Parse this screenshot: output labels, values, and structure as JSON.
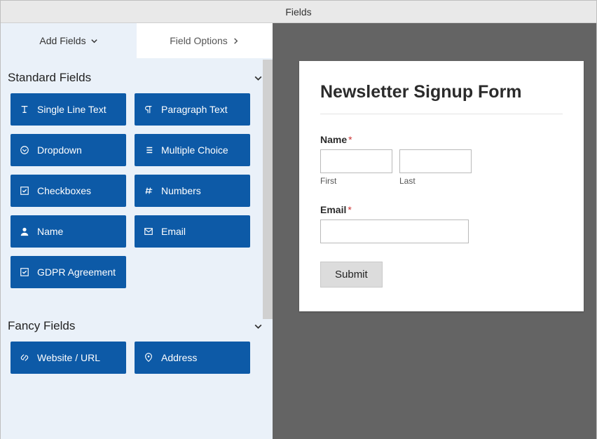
{
  "window": {
    "title": "Fields"
  },
  "tabs": {
    "add_fields": "Add Fields",
    "field_options": "Field Options"
  },
  "sections": {
    "standard": {
      "title": "Standard Fields",
      "fields": [
        {
          "label": "Single Line Text",
          "icon": "text-icon"
        },
        {
          "label": "Paragraph Text",
          "icon": "paragraph-icon"
        },
        {
          "label": "Dropdown",
          "icon": "dropdown-icon"
        },
        {
          "label": "Multiple Choice",
          "icon": "list-icon"
        },
        {
          "label": "Checkboxes",
          "icon": "checkbox-icon"
        },
        {
          "label": "Numbers",
          "icon": "hash-icon"
        },
        {
          "label": "Name",
          "icon": "user-icon"
        },
        {
          "label": "Email",
          "icon": "mail-icon"
        },
        {
          "label": "GDPR Agreement",
          "icon": "check-icon"
        }
      ]
    },
    "fancy": {
      "title": "Fancy Fields",
      "fields": [
        {
          "label": "Website / URL",
          "icon": "link-icon"
        },
        {
          "label": "Address",
          "icon": "pin-icon"
        }
      ]
    }
  },
  "form": {
    "title": "Newsletter Signup Form",
    "name_label": "Name",
    "first_sub": "First",
    "last_sub": "Last",
    "email_label": "Email",
    "required_mark": "*",
    "submit_label": "Submit"
  }
}
